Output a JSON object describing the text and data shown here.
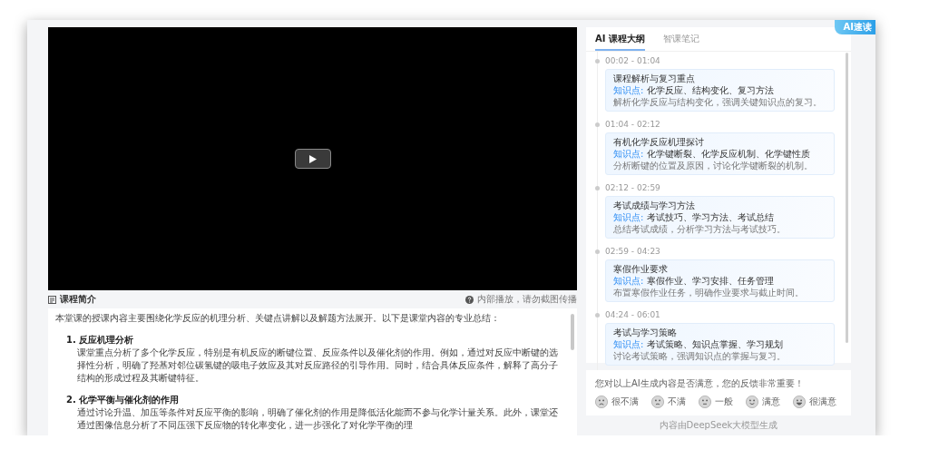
{
  "intro": {
    "title": "课程简介",
    "notice": "内部播放，请勿截图传播",
    "paragraphs": [
      {
        "kind": "text",
        "text": "本堂课的授课内容主要围绕化学反应的机理分析、关键点讲解以及解题方法展开。以下是课堂内容的专业总结："
      },
      {
        "kind": "heading",
        "text": "1. 反应机理分析"
      },
      {
        "kind": "body",
        "text": "课堂重点分析了多个化学反应，特别是有机反应的断键位置、反应条件以及催化剂的作用。例如，通过对反应中断键的选择性分析，明确了羟基对邻位碳氢键的吸电子效应及其对反应路径的引导作用。同时，结合具体反应条件，解释了高分子结构的形成过程及其断键特征。"
      },
      {
        "kind": "heading",
        "text": "2. 化学平衡与催化剂的作用"
      },
      {
        "kind": "body",
        "text": "通过讨论升温、加压等条件对反应平衡的影响，明确了催化剂的作用是降低活化能而不参与化学计量关系。此外，课堂还通过图像信息分析了不同压强下反应物的转化率变化，进一步强化了对化学平衡的理"
      }
    ]
  },
  "outline": {
    "badge": "AI速读",
    "tabs": [
      {
        "label": "AI 课程大纲",
        "selected": true
      },
      {
        "label": "智课笔记",
        "selected": false
      }
    ],
    "items": [
      {
        "time": "00:02 - 01:04",
        "title": "课程解析与复习重点",
        "label": "知识点:",
        "keywords": "化学反应、结构变化、复习方法",
        "summary": "解析化学反应与结构变化，强调关键知识点的复习。"
      },
      {
        "time": "01:04 - 02:12",
        "title": "有机化学反应机理探讨",
        "label": "知识点:",
        "keywords": "化学键断裂、化学反应机制、化学键性质",
        "summary": "分析断键的位置及原因，讨论化学键断裂的机制。"
      },
      {
        "time": "02:12 - 02:59",
        "title": "考试成绩与学习方法",
        "label": "知识点:",
        "keywords": "考试技巧、学习方法、考试总结",
        "summary": "总结考试成绩，分析学习方法与考试技巧。"
      },
      {
        "time": "02:59 - 04:23",
        "title": "寒假作业要求",
        "label": "知识点:",
        "keywords": "寒假作业、学习安排、任务管理",
        "summary": "布置寒假作业任务，明确作业要求与截止时间。"
      },
      {
        "time": "04:24 - 06:01",
        "title": "考试与学习策略",
        "label": "知识点:",
        "keywords": "考试策略、知识点掌握、学习规划",
        "summary": "讨论考试策略，强调知识点的掌握与复习。"
      }
    ]
  },
  "feedback": {
    "question": "您对以上AI生成内容是否满意，您的反馈非常重要！",
    "options": [
      {
        "label": "很不满",
        "kind": "awful"
      },
      {
        "label": "不满",
        "kind": "bad"
      },
      {
        "label": "一般",
        "kind": "neutral"
      },
      {
        "label": "满意",
        "kind": "good"
      },
      {
        "label": "很满意",
        "kind": "great"
      }
    ]
  },
  "footer": "内容由DeepSeek大模型生成"
}
